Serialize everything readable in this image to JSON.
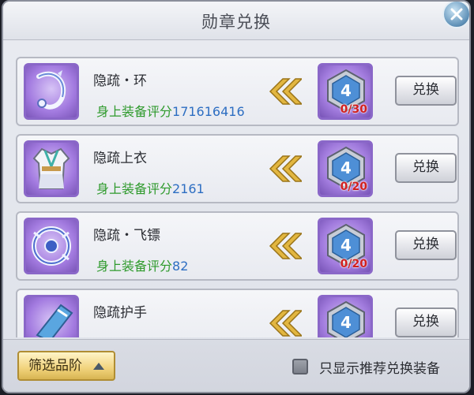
{
  "window": {
    "title": "勋章兑换"
  },
  "items": [
    {
      "name": "隐疏・环",
      "score_label": "身上装备评分",
      "score_value": "171616416",
      "medal_count": "0/30",
      "button": "兑换",
      "icon": "ring-icon"
    },
    {
      "name": "隐疏上衣",
      "score_label": "身上装备评分",
      "score_value": "2161",
      "medal_count": "0/20",
      "button": "兑换",
      "icon": "robe-icon"
    },
    {
      "name": "隐疏・飞镖",
      "score_label": "身上装备评分",
      "score_value": "82",
      "medal_count": "0/20",
      "button": "兑换",
      "icon": "dart-icon"
    },
    {
      "name": "隐疏护手",
      "score_label": "",
      "score_value": "",
      "medal_count": "",
      "button": "兑换",
      "icon": "gauntlet-icon"
    }
  ],
  "footer": {
    "filter_label": "筛选品阶",
    "checkbox_label": "只显示推荐兑换装备",
    "checkbox_checked": false
  },
  "colors": {
    "score_label": "#2e9a2c",
    "score_value": "#2d6ec2",
    "medal_count": "#d11f1f",
    "icon_frame": "#8a67c8",
    "filter_button": "#f1d37c"
  }
}
